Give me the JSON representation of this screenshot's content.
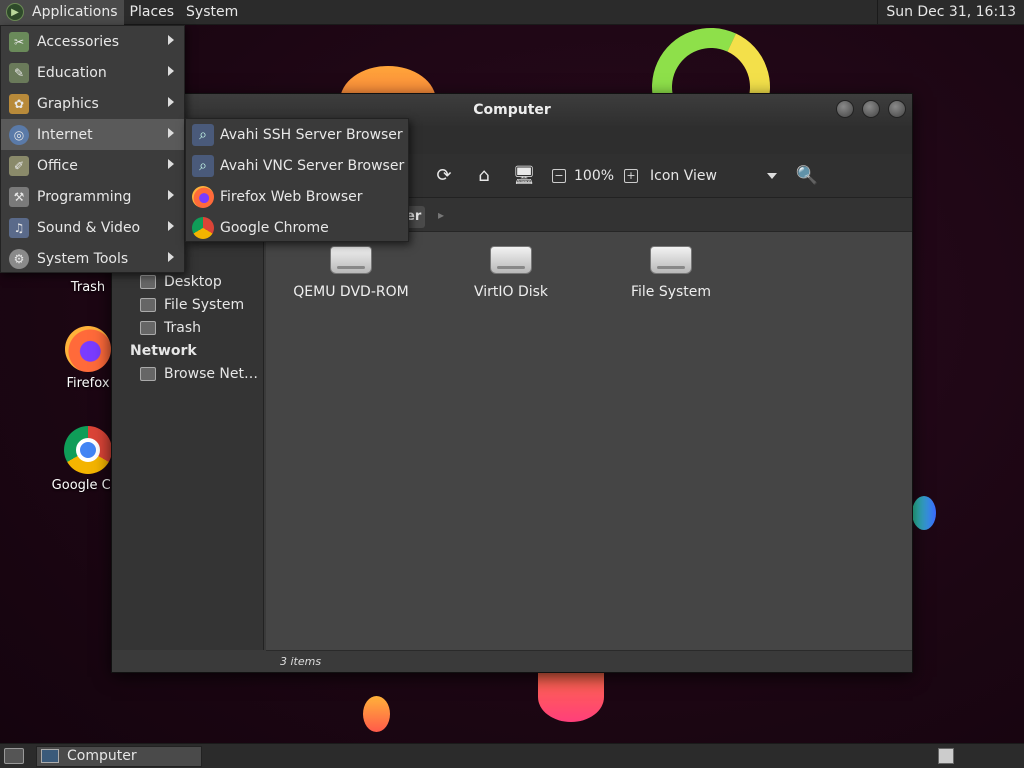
{
  "top_panel": {
    "applications": "Applications",
    "places": "Places",
    "system": "System",
    "clock": "Sun Dec 31, 16:13"
  },
  "apps_menu": {
    "items": [
      {
        "label": "Accessories",
        "icon": "accessories-icon"
      },
      {
        "label": "Education",
        "icon": "education-icon"
      },
      {
        "label": "Graphics",
        "icon": "graphics-icon"
      },
      {
        "label": "Internet",
        "icon": "internet-icon"
      },
      {
        "label": "Office",
        "icon": "office-icon"
      },
      {
        "label": "Programming",
        "icon": "programming-icon"
      },
      {
        "label": "Sound & Video",
        "icon": "sound-video-icon"
      },
      {
        "label": "System Tools",
        "icon": "system-tools-icon"
      }
    ]
  },
  "internet_submenu": {
    "items": [
      {
        "label": "Avahi SSH Server Browser",
        "icon": "avahi-ssh-icon"
      },
      {
        "label": "Avahi VNC Server Browser",
        "icon": "avahi-vnc-icon"
      },
      {
        "label": "Firefox Web Browser",
        "icon": "firefox-icon"
      },
      {
        "label": "Google Chrome",
        "icon": "chrome-icon"
      }
    ]
  },
  "desktop_icons": {
    "trash": "Trash",
    "firefox": "Firefox",
    "chrome": "Google Chr"
  },
  "window": {
    "title": "Computer",
    "toolbar": {
      "zoom": "100%",
      "view": "Icon View"
    },
    "location": {
      "crumb": "er"
    },
    "sidebar": {
      "items": [
        {
          "label": "Desktop",
          "icon": "desktop-folder-icon"
        },
        {
          "label": "File System",
          "icon": "file-system-icon"
        },
        {
          "label": "Trash",
          "icon": "trash-icon"
        }
      ],
      "network_heading": "Network",
      "network_items": [
        {
          "label": "Browse Net…",
          "icon": "network-icon"
        }
      ]
    },
    "drives": [
      {
        "label": "QEMU DVD-ROM",
        "icon": "optical-drive-icon"
      },
      {
        "label": "VirtIO Disk",
        "icon": "hard-disk-icon"
      },
      {
        "label": "File System",
        "icon": "hard-disk-icon"
      }
    ],
    "status": "3 items"
  },
  "bottom_panel": {
    "task": "Computer"
  }
}
